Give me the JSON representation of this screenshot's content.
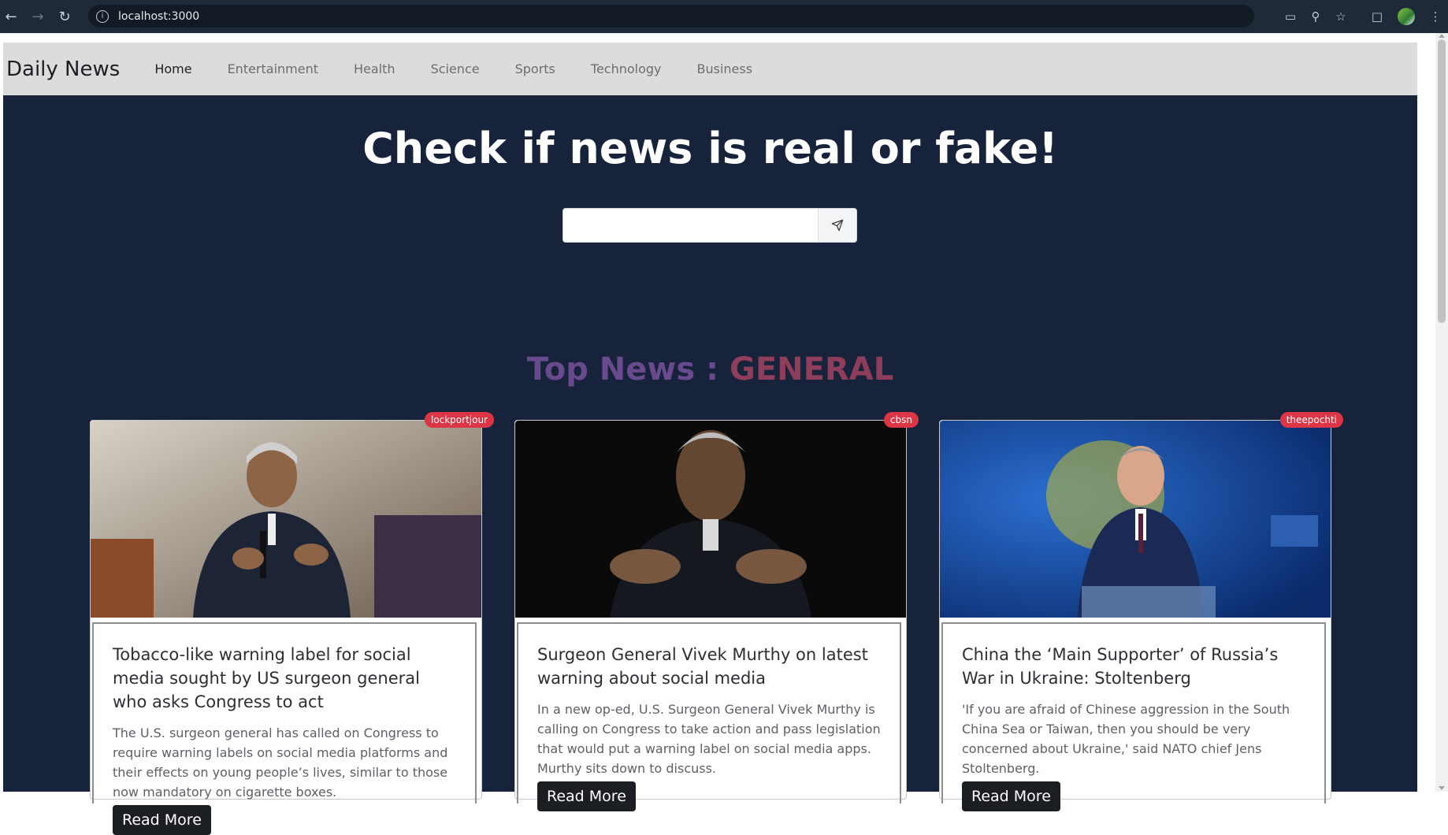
{
  "browser": {
    "url": "localhost:3000"
  },
  "navbar": {
    "brand": "Daily News",
    "links": [
      "Home",
      "Entertainment",
      "Health",
      "Science",
      "Sports",
      "Technology",
      "Business"
    ],
    "active": "Home"
  },
  "hero": {
    "headline": "Check if news is real or fake!",
    "search_value": "",
    "search_placeholder": ""
  },
  "section": {
    "prefix": "Top News : ",
    "category": "GENERAL"
  },
  "cards": [
    {
      "source": "lockportjour",
      "title": "Tobacco-like warning label for social media sought by US surgeon general who asks Congress to act",
      "description": "The U.S. surgeon general has called on Congress to require warning labels on social media platforms and their effects on young people’s lives, similar to those now mandatory on cigarette boxes.",
      "button": "Read More"
    },
    {
      "source": "cbsn",
      "title": "Surgeon General Vivek Murthy on latest warning about social media",
      "description": "In a new op-ed, U.S. Surgeon General Vivek Murthy is calling on Congress to take action and pass legislation that would put a warning label on social media apps. Murthy sits down to discuss.",
      "button": "Read More"
    },
    {
      "source": "theepochti",
      "title": "China the ‘Main Supporter’ of Russia’s War in Ukraine: Stoltenberg",
      "description": "'If you are afraid of Chinese aggression in the South China Sea or Taiwan, then you should be very concerned about Ukraine,' said NATO chief Jens Stoltenberg.",
      "button": "Read More"
    }
  ],
  "colors": {
    "hero_bg": "#17223b",
    "navbar_bg": "#dcdcdc",
    "badge": "#dc3545",
    "title_prefix": "#6a4a8f",
    "title_category": "#8e3d5b"
  }
}
